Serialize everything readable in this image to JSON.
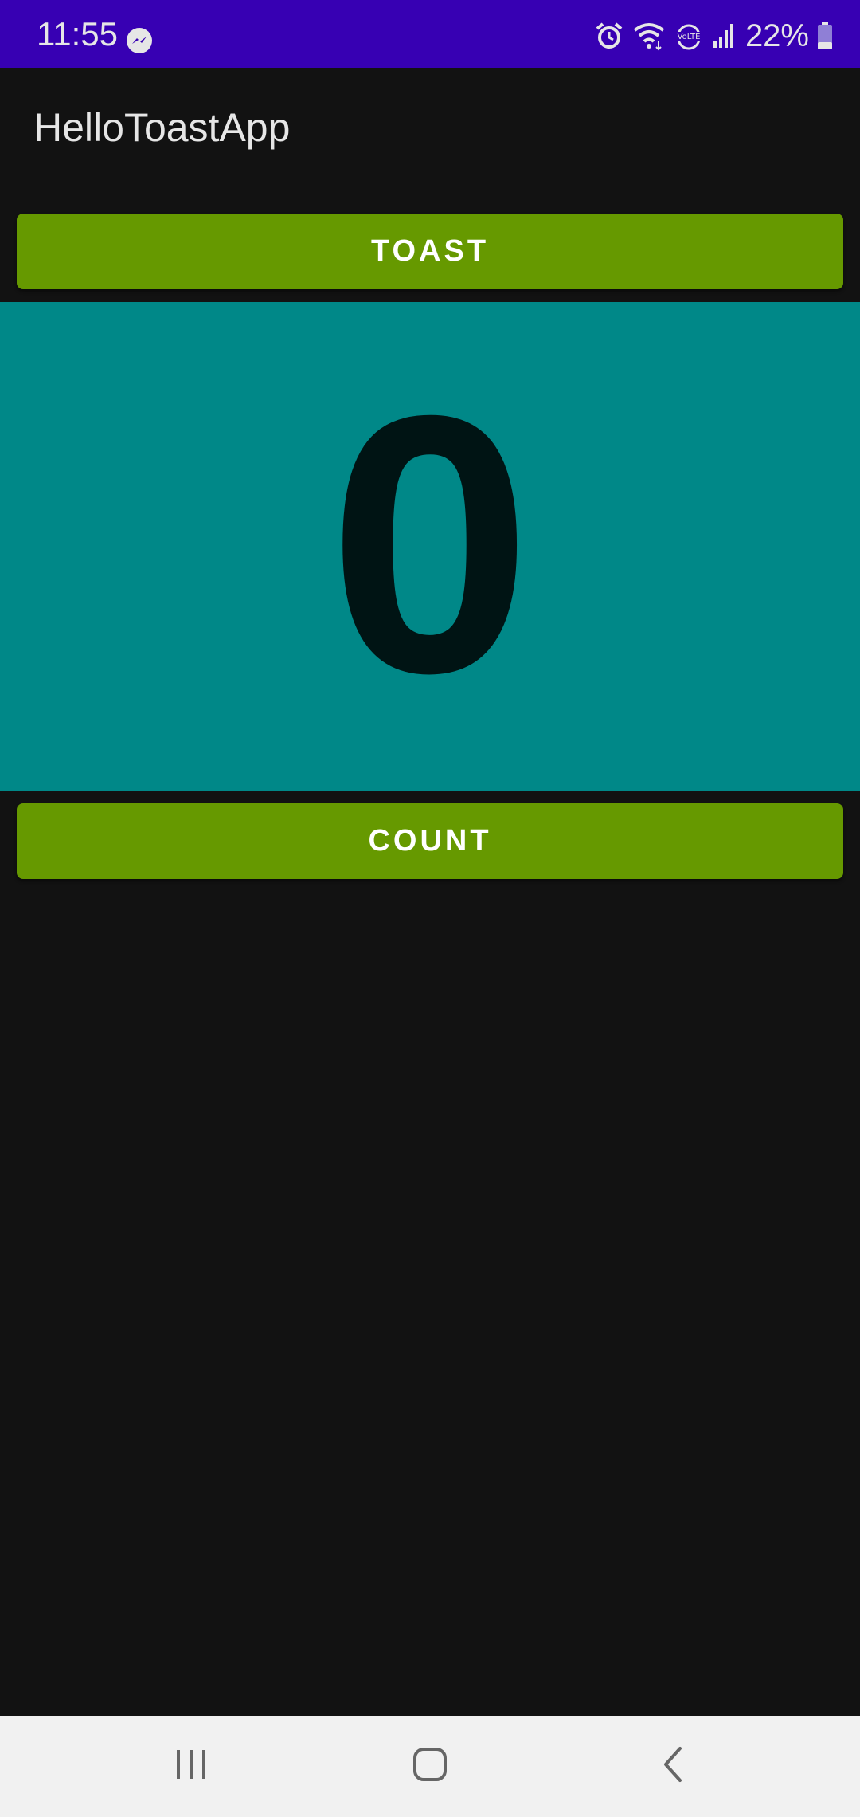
{
  "status_bar": {
    "time": "11:55",
    "notification_icon": "messenger-icon",
    "icons": [
      "alarm-icon",
      "wifi-icon",
      "volte-icon",
      "signal-icon",
      "battery-icon"
    ],
    "battery_percent": "22%",
    "color": "#3700b3"
  },
  "app_bar": {
    "title": "HelloToastApp"
  },
  "toast_button": {
    "label": "TOAST",
    "color": "#669900"
  },
  "count_display": {
    "value": "0",
    "background": "#008888"
  },
  "count_button": {
    "label": "COUNT",
    "color": "#669900"
  },
  "nav_bar": {
    "buttons": [
      "recents-icon",
      "home-icon",
      "back-icon"
    ]
  }
}
